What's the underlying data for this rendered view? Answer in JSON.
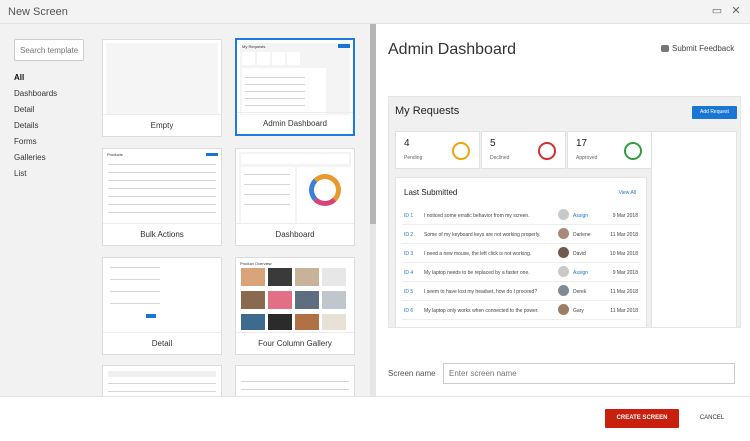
{
  "window": {
    "title": "New Screen",
    "restore_glyph": "▭",
    "close_glyph": "✕"
  },
  "sidebar": {
    "search_placeholder": "Search templates",
    "categories": [
      {
        "label": "All",
        "active": true
      },
      {
        "label": "Dashboards",
        "active": false
      },
      {
        "label": "Detail",
        "active": false
      },
      {
        "label": "Details",
        "active": false
      },
      {
        "label": "Forms",
        "active": false
      },
      {
        "label": "Galleries",
        "active": false
      },
      {
        "label": "List",
        "active": false
      }
    ]
  },
  "templates": [
    {
      "label": "Empty",
      "selected": false
    },
    {
      "label": "Admin Dashboard",
      "selected": true
    },
    {
      "label": "Bulk Actions",
      "selected": false
    },
    {
      "label": "Dashboard",
      "selected": false
    },
    {
      "label": "Detail",
      "selected": false
    },
    {
      "label": "Four Column Gallery",
      "selected": false
    }
  ],
  "preview": {
    "title": "Admin Dashboard",
    "feedback_label": "Submit Feedback",
    "heading": "My Requests",
    "add_button": "Add Request",
    "cards": [
      {
        "value": "4",
        "label": "Pending",
        "icon": "clock-icon",
        "color": "#f0a30a"
      },
      {
        "value": "5",
        "label": "Declined",
        "icon": "x-circle-icon",
        "color": "#d32f2f"
      },
      {
        "value": "17",
        "label": "Approved",
        "icon": "check-circle-icon",
        "color": "#2e9e3e"
      }
    ],
    "last_title": "Last Submitted",
    "view_all": "View All",
    "rows": [
      {
        "id": "ID 1",
        "text": "I noticed some erratic behavior from my screen.",
        "who": "Assign",
        "link": true,
        "date": "9 Mar 2018"
      },
      {
        "id": "ID 2",
        "text": "Some of my keyboard keys are not working properly.",
        "who": "Darlene",
        "link": false,
        "date": "11 Mar 2018"
      },
      {
        "id": "ID 3",
        "text": "I need a new mouse, the left click is not working.",
        "who": "David",
        "link": false,
        "date": "10 Mar 2018"
      },
      {
        "id": "ID 4",
        "text": "My laptop needs to be replaced by a faster one.",
        "who": "Assign",
        "link": true,
        "date": "9 Mar 2018"
      },
      {
        "id": "ID 5",
        "text": "I seem to have lost my headset, how do I proceed?",
        "who": "Derek",
        "link": false,
        "date": "11 Mar 2018"
      },
      {
        "id": "ID 6",
        "text": "My laptop only works when connected to the power.",
        "who": "Gary",
        "link": false,
        "date": "11 Mar 2018"
      }
    ]
  },
  "screen_name": {
    "label": "Screen name",
    "placeholder": "Enter screen name"
  },
  "footer": {
    "create": "CREATE SCREEN",
    "cancel": "CANCEL"
  },
  "thumb_texts": {
    "admin_heading": "My Requests",
    "bulk_heading": "Products",
    "gallery_heading": "Product Overview"
  }
}
